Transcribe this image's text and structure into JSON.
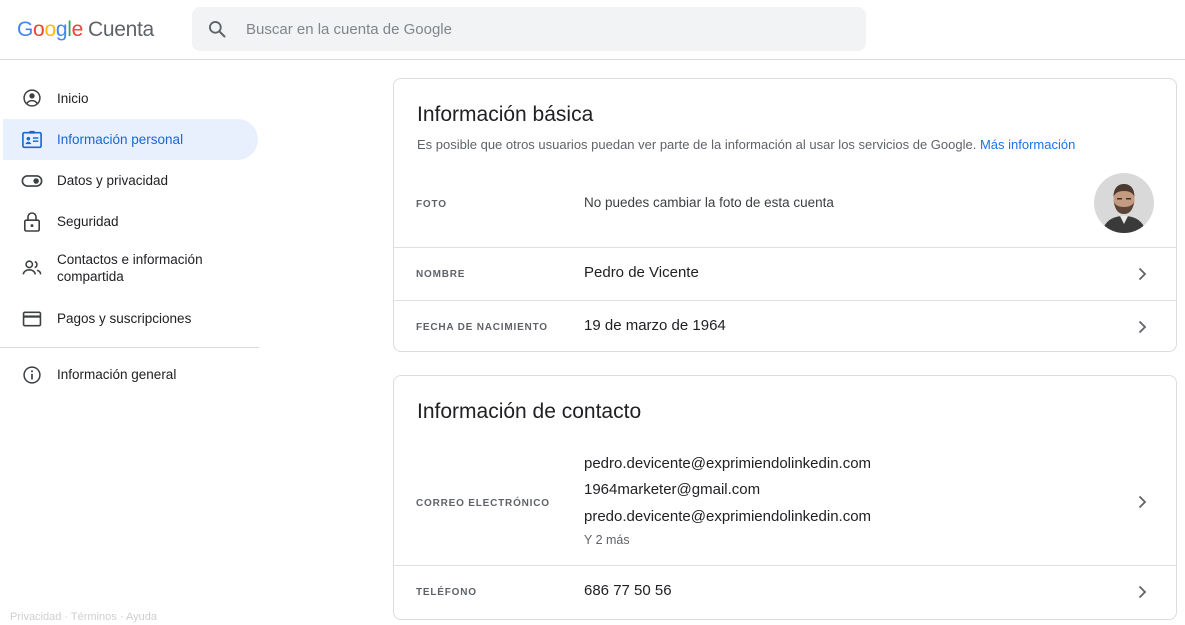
{
  "header": {
    "logo_text": "Google",
    "product_name": "Cuenta",
    "search_placeholder": "Buscar en la cuenta de Google"
  },
  "sidebar": {
    "items": [
      {
        "label": "Inicio",
        "icon": "account-circle-icon",
        "active": false
      },
      {
        "label": "Información personal",
        "icon": "id-card-icon",
        "active": true
      },
      {
        "label": "Datos y privacidad",
        "icon": "toggle-icon",
        "active": false
      },
      {
        "label": "Seguridad",
        "icon": "lock-icon",
        "active": false
      },
      {
        "label": "Contactos e información compartida",
        "label_line1": "Contactos e información",
        "label_line2": "compartida",
        "icon": "people-icon",
        "active": false
      },
      {
        "label": "Pagos y suscripciones",
        "icon": "credit-card-icon",
        "active": false
      },
      {
        "label": "Información general",
        "icon": "info-icon",
        "active": false
      }
    ],
    "footer_text": "Privacidad · Términos · Ayuda"
  },
  "basic_info": {
    "title": "Información básica",
    "description": "Es posible que otros usuarios puedan ver parte de la información al usar los servicios de Google.",
    "more_info_link": "Más información",
    "photo_label": "Foto",
    "photo_text": "No puedes cambiar la foto de esta cuenta",
    "name_label": "Nombre",
    "name_value": "Pedro de Vicente",
    "birth_label": "Fecha de nacimiento",
    "birth_value": "19 de marzo de 1964"
  },
  "contact_info": {
    "title": "Información de contacto",
    "email_label": "Correo electrónico",
    "emails": [
      "pedro.devicente@exprimiendolinkedin.com",
      "1964marketer@gmail.com",
      "predo.devicente@exprimiendolinkedin.com"
    ],
    "more_emails": "Y 2 más",
    "phone_label": "Teléfono",
    "phone_value": "686 77 50 56"
  },
  "colors": {
    "accent": "#1a73e8",
    "active_bg": "#e8f0fe",
    "active_text": "#1967d2",
    "border": "#dadce0"
  }
}
